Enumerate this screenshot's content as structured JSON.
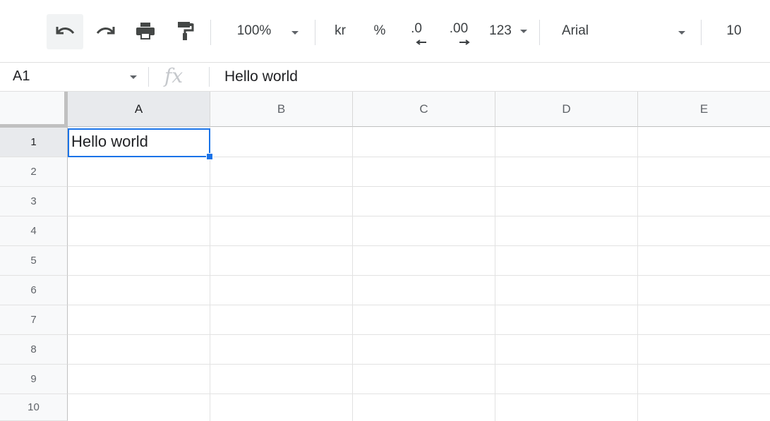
{
  "toolbar": {
    "zoom": "100%",
    "currency": "kr",
    "percent": "%",
    "decrease_decimal": ".0",
    "increase_decimal": ".00",
    "more_formats": "123",
    "font": "Arial",
    "font_size": "10",
    "icons": [
      "undo-icon",
      "redo-icon",
      "print-icon",
      "paint-format-icon"
    ]
  },
  "formula_bar": {
    "name_box": "A1",
    "fx": "fx",
    "value": "Hello world"
  },
  "grid": {
    "columns": [
      "A",
      "B",
      "C",
      "D",
      "E"
    ],
    "rows": [
      "1",
      "2",
      "3",
      "4",
      "5",
      "6",
      "7",
      "8",
      "9",
      "10"
    ],
    "cells": {
      "A1": "Hello world"
    },
    "selected_cell": "A1"
  },
  "colors": {
    "selection": "#1a73e8"
  }
}
